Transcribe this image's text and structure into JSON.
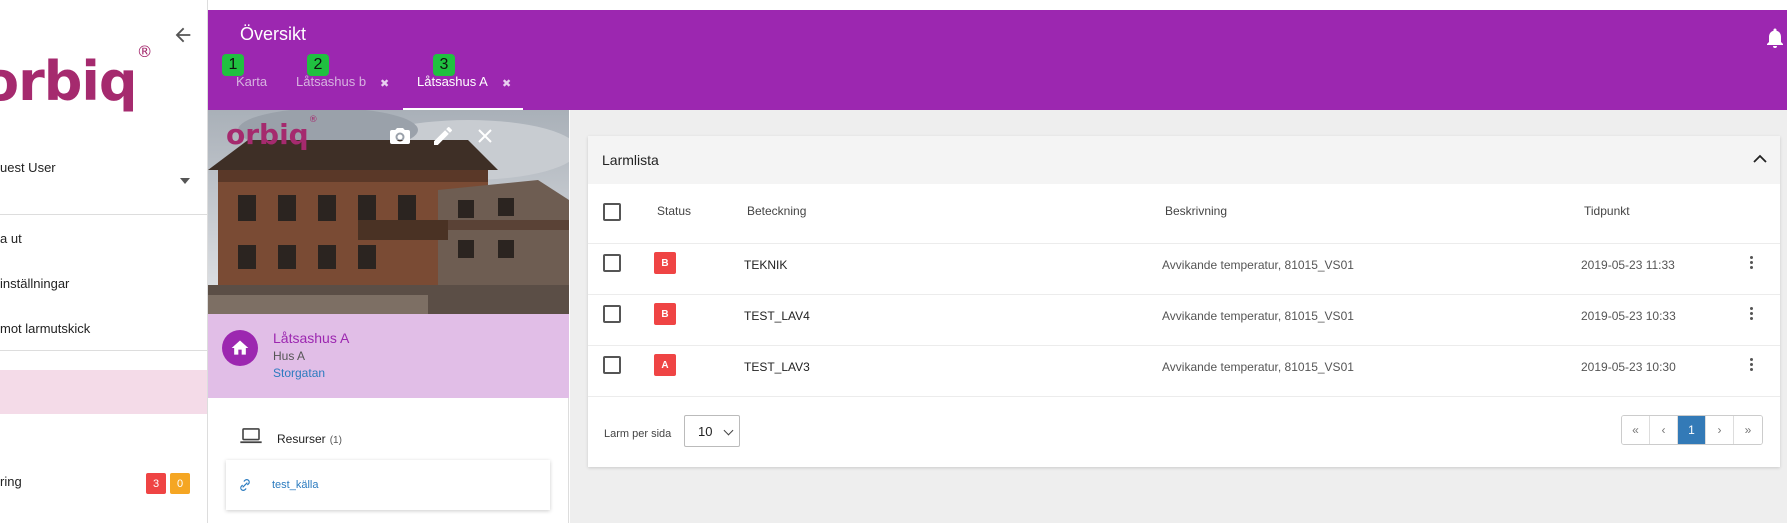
{
  "sidebar": {
    "user_name": "uest User",
    "menu": [
      "a ut",
      "inställningar",
      "mot larmutskick"
    ],
    "bottom_item": "ring",
    "badge_red": "3",
    "badge_orange": "0",
    "logo_text": "orbiq",
    "logo_mark": "®"
  },
  "header": {
    "title": "Översikt",
    "tabs": [
      {
        "label": "Karta",
        "number": "1",
        "closable": false
      },
      {
        "label": "Låtsashus b",
        "number": "2",
        "closable": true
      },
      {
        "label": "Låtsashus A",
        "number": "3",
        "closable": true,
        "active": true
      }
    ],
    "close_glyph": "✖"
  },
  "building": {
    "logo_text": "orbiq",
    "logo_mark": "®",
    "name": "Låtsashus A",
    "subtitle": "Hus A",
    "address": "Storgatan",
    "resources_label": "Resurser",
    "resources_count": "(1)",
    "resource_items": [
      "test_källa"
    ]
  },
  "alarm_list": {
    "title": "Larmlista",
    "columns": [
      "Status",
      "Beteckning",
      "Beskrivning",
      "Tidpunkt"
    ],
    "rows": [
      {
        "status": "B",
        "id": "TEKNIK",
        "description": "Avvikande temperatur, 81015_VS01",
        "time": "2019-05-23 11:33"
      },
      {
        "status": "B",
        "id": "TEST_LAV4",
        "description": "Avvikande temperatur, 81015_VS01",
        "time": "2019-05-23 10:33"
      },
      {
        "status": "A",
        "id": "TEST_LAV3",
        "description": "Avvikande temperatur, 81015_VS01",
        "time": "2019-05-23 10:30"
      }
    ],
    "per_page_label": "Larm per sida",
    "per_page_value": "10",
    "pager": [
      "«",
      "‹",
      "1",
      "›",
      "»"
    ],
    "current_page": "1"
  },
  "colors": {
    "header": "#9c27b0",
    "info_panel": "#e1bee7",
    "status_red": "#ef4444",
    "badge_orange": "#f5a623",
    "tab_number": "#20c040",
    "pager_active": "#337ab7"
  }
}
